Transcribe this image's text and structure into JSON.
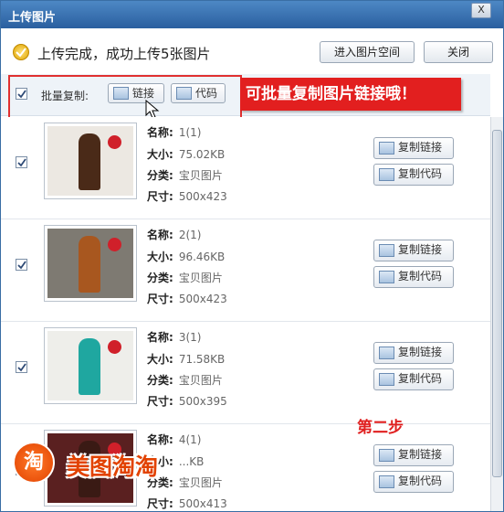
{
  "window": {
    "title": "上传图片",
    "close_glyph": "X"
  },
  "status": {
    "text": "上传完成，成功上传5张图片"
  },
  "buttons": {
    "open_space": "进入图片空间",
    "close": "关闭"
  },
  "batch": {
    "label": "批量复制:",
    "link_btn": "链接",
    "code_btn": "代码"
  },
  "annotations": {
    "callout": "可批量复制图片链接哦！",
    "step": "第二步"
  },
  "watermark": {
    "badge": "淘",
    "text": "美图淘淘"
  },
  "labels": {
    "name": "名称:",
    "size": "大小:",
    "category": "分类:",
    "dimensions": "尺寸:",
    "copy_link": "复制链接",
    "copy_code": "复制代码"
  },
  "items": [
    {
      "name": "1(1)",
      "size": "75.02KB",
      "category": "宝贝图片",
      "dimensions": "500x423",
      "checked": true,
      "coat_color": "#4a2a18",
      "bg_color": "#ece8e2"
    },
    {
      "name": "2(1)",
      "size": "96.46KB",
      "category": "宝贝图片",
      "dimensions": "500x423",
      "checked": true,
      "coat_color": "#a8571f",
      "bg_color": "#7e7a72"
    },
    {
      "name": "3(1)",
      "size": "71.58KB",
      "category": "宝贝图片",
      "dimensions": "500x395",
      "checked": true,
      "coat_color": "#1fa7a0",
      "bg_color": "#eeeeea"
    },
    {
      "name": "4(1)",
      "size": "...KB",
      "category": "宝贝图片",
      "dimensions": "500x413",
      "checked": false,
      "coat_color": "#3a1a14",
      "bg_color": "#5a2020"
    }
  ]
}
